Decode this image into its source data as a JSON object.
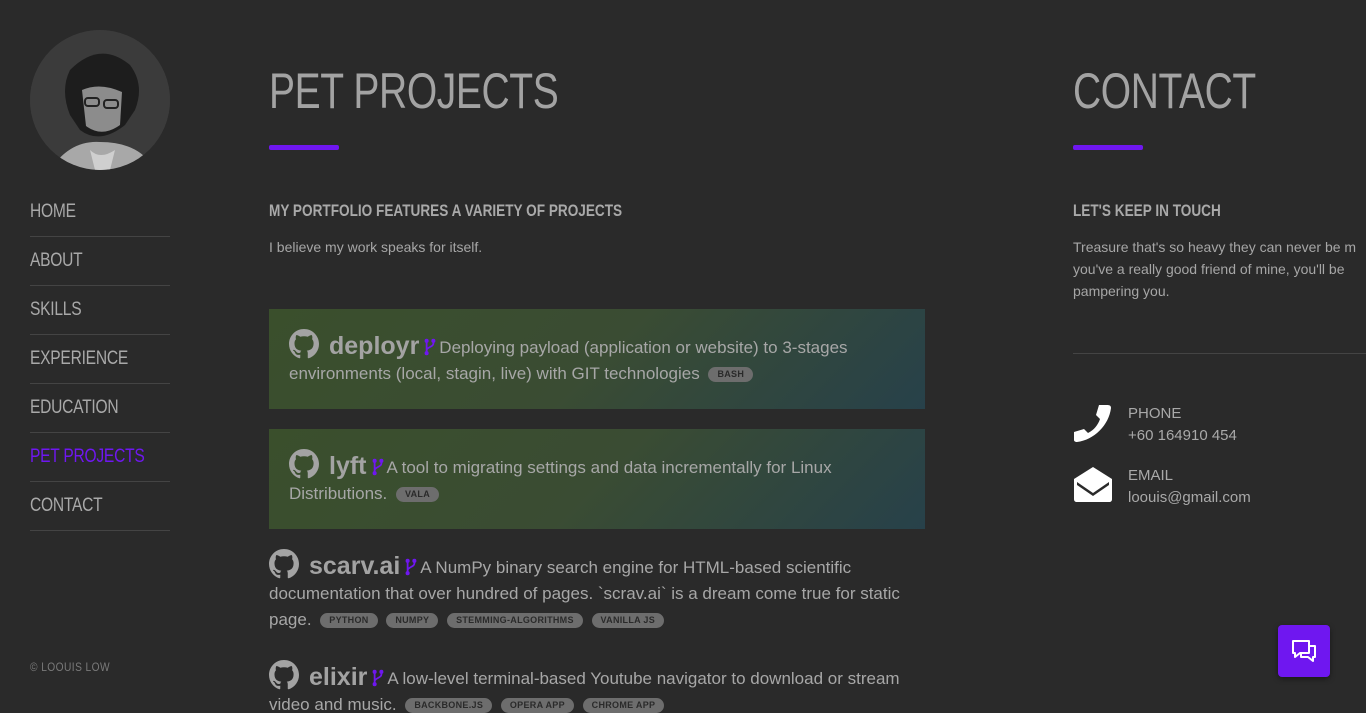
{
  "sidebar": {
    "nav": [
      {
        "label": "HOME"
      },
      {
        "label": "ABOUT"
      },
      {
        "label": "SKILLS"
      },
      {
        "label": "EXPERIENCE"
      },
      {
        "label": "EDUCATION"
      },
      {
        "label": "PET PROJECTS",
        "active": true
      },
      {
        "label": "CONTACT"
      }
    ],
    "copyright": "© LOOUIS LOW"
  },
  "projects_section": {
    "title": "PET PROJECTS",
    "subtitle": "MY PORTFOLIO FEATURES A VARIETY OF PROJECTS",
    "intro": "I believe my work speaks for itself.",
    "items": [
      {
        "name": "deployr",
        "desc_1": "Deploying payload (application or website) to 3-stages",
        "desc_2": "environments (local, stagin, live) with GIT technologies",
        "tags": [
          "BASH"
        ],
        "featured": true
      },
      {
        "name": "lyft",
        "desc_1": "A tool to migrating settings and data incrementally for Linux",
        "desc_2": "Distributions.",
        "tags": [
          "VALA"
        ],
        "featured": true
      },
      {
        "name": "scarv.ai",
        "desc_1": "A NumPy binary search engine for HTML-based scientific",
        "desc_2": "documentation that over hundred of pages. `scrav.ai` is a dream come true for static",
        "desc_3": "page.",
        "tags": [
          "PYTHON",
          "NUMPY",
          "STEMMING-ALGORITHMS",
          "VANILLA JS"
        ]
      },
      {
        "name": "elixir",
        "desc_1": "A low-level terminal-based Youtube navigator to download or stream",
        "desc_2": "video and music.",
        "tags": [
          "BACKBONE.JS",
          "OPERA APP",
          "CHROME APP"
        ]
      }
    ]
  },
  "contact_section": {
    "title": "CONTACT",
    "subtitle": "LET'S KEEP IN TOUCH",
    "text_1": "Treasure that's so heavy they can never be m",
    "text_2": "you've a really good friend of mine, you'll be",
    "text_3": "pampering you.",
    "phone_label": "PHONE",
    "phone_value": "+60 164910 454",
    "email_label": "EMAIL",
    "email_value": "loouis@gmail.com"
  },
  "colors": {
    "accent": "#6f17f0",
    "background": "#2a2a2a"
  },
  "icons": {
    "github": "github-icon",
    "fork": "fork-icon",
    "phone": "phone-icon",
    "email": "envelope-icon",
    "chat": "chat-icon"
  }
}
